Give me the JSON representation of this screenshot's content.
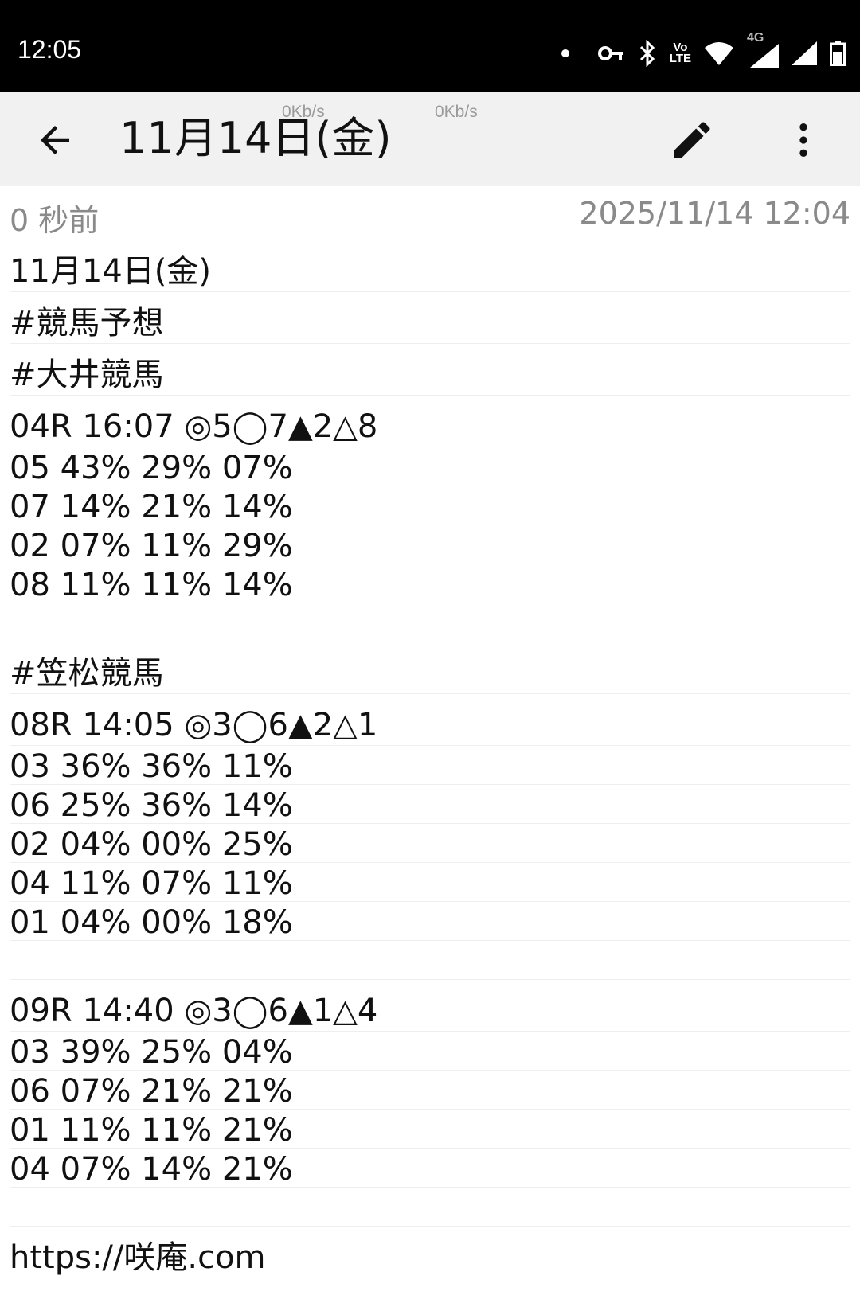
{
  "status_bar": {
    "time": "12:05",
    "icons": [
      "dot-icon",
      "vpn-key-icon",
      "bluetooth-icon",
      "volte-icon",
      "wifi-icon",
      "signal-4g-icon",
      "signal-icon",
      "battery-icon"
    ],
    "network_label": "4G",
    "volte_label_top": "Vo",
    "volte_label_bottom": "LTE"
  },
  "app_bar": {
    "title": "11月14日(金)",
    "speed_1": "0Kb/s",
    "speed_2": "0Kb/s"
  },
  "meta": {
    "relative_time": "0 秒前",
    "datetime": "2025/11/14 12:04"
  },
  "note_lines": [
    "11月14日(金)",
    "#競馬予想",
    "#大井競馬",
    "04R 16:07 ◎5◯7▲2△8",
    "05 43% 29% 07%",
    "07 14% 21% 14%",
    "02 07% 11% 29%",
    "08 11% 11% 14%",
    "",
    "#笠松競馬",
    "08R 14:05 ◎3◯6▲2△1",
    "03 36% 36% 11%",
    "06 25% 36% 14%",
    "02 04% 00% 25%",
    "04 11% 07% 11%",
    "01 04% 00% 18%",
    "",
    "09R 14:40 ◎3◯6▲1△4",
    "03 39% 25% 04%",
    "06 07% 21% 21%",
    "01 11% 11% 21%",
    "04 07% 14% 21%",
    "",
    "https://咲庵.com"
  ]
}
